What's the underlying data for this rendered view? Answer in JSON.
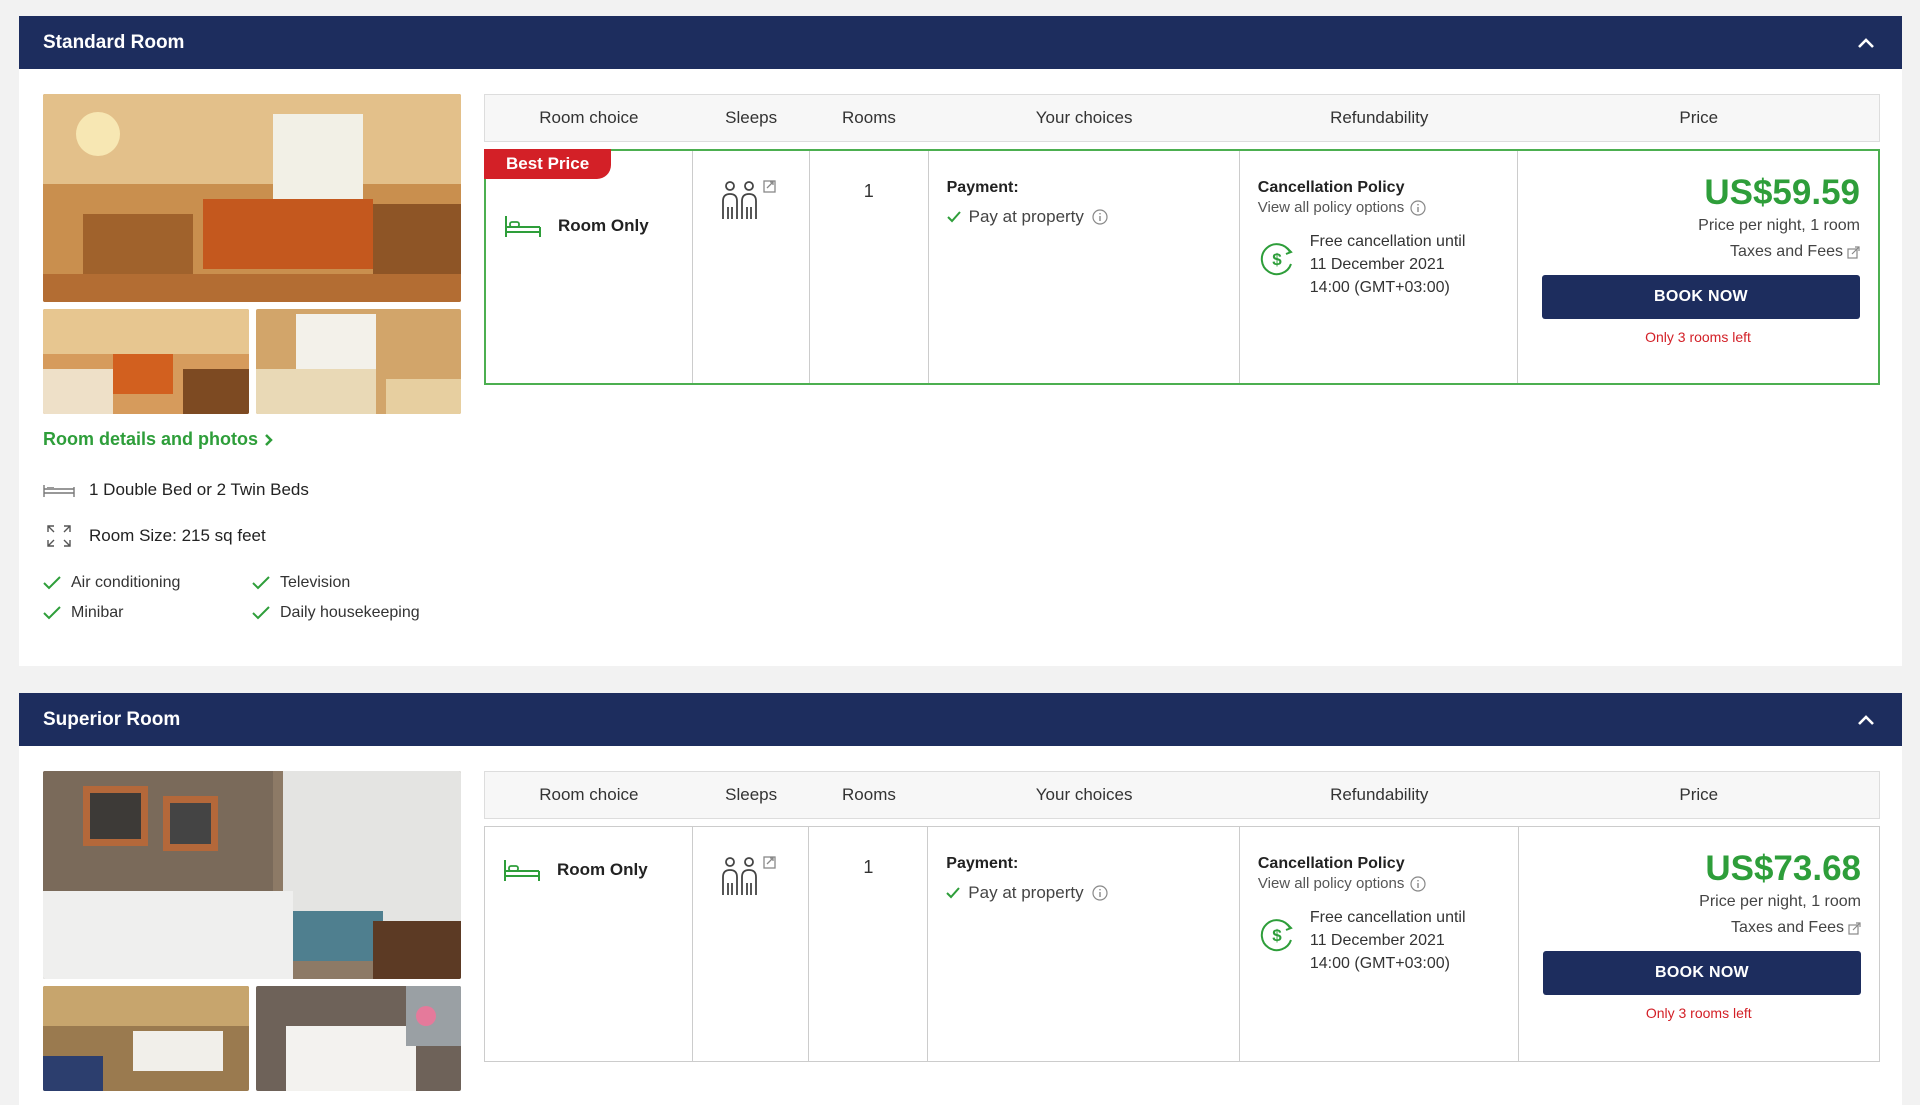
{
  "rooms": [
    {
      "title": "Standard Room",
      "details_link": "Room details and photos",
      "bed": "1 Double Bed or 2 Twin Beds",
      "size": "Room Size: 215 sq feet",
      "amenities": [
        "Air conditioning",
        "Television",
        "Minibar",
        "Daily housekeeping"
      ],
      "table": {
        "headers": [
          "Room choice",
          "Sleeps",
          "Rooms",
          "Your choices",
          "Refundability",
          "Price"
        ],
        "row": {
          "badge": "Best Price",
          "choice": "Room Only",
          "rooms": "1",
          "payment_label": "Payment:",
          "payment_value": "Pay at property",
          "policy_title": "Cancellation Policy",
          "policy_link": "View all policy options",
          "free_line1": "Free cancellation until",
          "free_line2": "11 December 2021",
          "free_line3": "14:00 (GMT+03:00)",
          "price": "US$59.59",
          "price_sub": "Price per night, 1 room",
          "taxes": "Taxes and Fees",
          "book_label": "BOOK NOW",
          "rooms_left": "Only 3 rooms left"
        }
      }
    },
    {
      "title": "Superior Room",
      "table": {
        "headers": [
          "Room choice",
          "Sleeps",
          "Rooms",
          "Your choices",
          "Refundability",
          "Price"
        ],
        "row": {
          "choice": "Room Only",
          "rooms": "1",
          "payment_label": "Payment:",
          "payment_value": "Pay at property",
          "policy_title": "Cancellation Policy",
          "policy_link": "View all policy options",
          "free_line1": "Free cancellation until",
          "free_line2": "11 December 2021",
          "free_line3": "14:00 (GMT+03:00)",
          "price": "US$73.68",
          "price_sub": "Price per night, 1 room",
          "taxes": "Taxes and Fees",
          "book_label": "BOOK NOW",
          "rooms_left": "Only 3 rooms left"
        }
      }
    }
  ],
  "colors": {
    "header": "#1d2d5e",
    "accent_green": "#2e9e3a",
    "badge_red": "#d32027"
  }
}
